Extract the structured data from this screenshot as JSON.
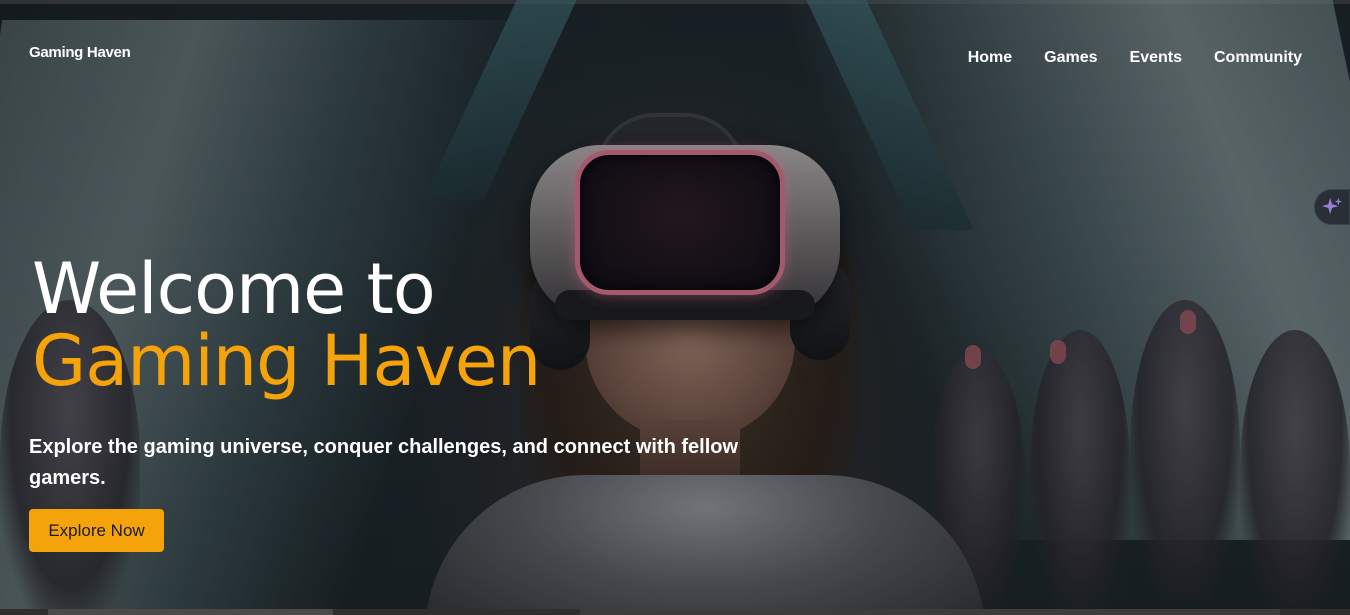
{
  "header": {
    "brand": "Gaming Haven",
    "nav": [
      {
        "label": "Home"
      },
      {
        "label": "Games"
      },
      {
        "label": "Events"
      },
      {
        "label": "Community"
      }
    ]
  },
  "hero": {
    "title_line1": "Welcome to",
    "title_line2": "Gaming Haven",
    "subtitle": "Explore the gaming universe, conquer challenges, and connect with fellow gamers.",
    "cta_label": "Explore Now"
  },
  "colors": {
    "accent": "#f5a30b",
    "text": "#ffffff",
    "sparkle": "#9b7fd4"
  },
  "icons": {
    "side_tool": "sparkle-icon"
  }
}
